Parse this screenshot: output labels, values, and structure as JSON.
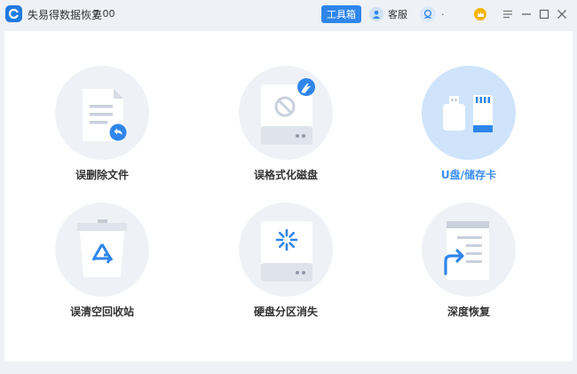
{
  "app": {
    "title": "失易得数据恢复",
    "version": "7.00"
  },
  "header": {
    "toolbox_label": "工具箱",
    "service_label": "客服",
    "user_name": "·"
  },
  "colors": {
    "accent": "#2f86ea",
    "active_text": "#3d8ff0",
    "active_circle": "#cfe4fb",
    "circle": "#eef2f7"
  },
  "tiles": [
    {
      "label": "误删除文件",
      "icon": "deleted-file-icon"
    },
    {
      "label": "误格式化磁盘",
      "icon": "formatted-disk-icon"
    },
    {
      "label": "U盘/储存卡",
      "icon": "usb-sdcard-icon",
      "active": true
    },
    {
      "label": "误清空回收站",
      "icon": "recycle-bin-icon"
    },
    {
      "label": "硬盘分区消失",
      "icon": "lost-partition-icon"
    },
    {
      "label": "深度恢复",
      "icon": "deep-recovery-icon"
    }
  ]
}
